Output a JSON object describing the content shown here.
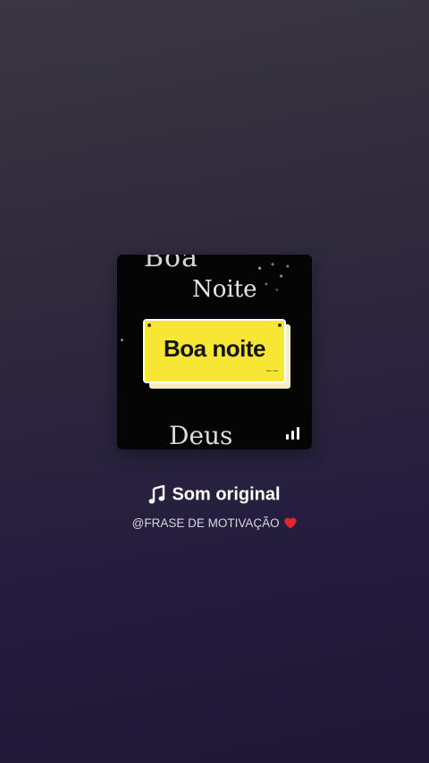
{
  "cover": {
    "text_top": "Boa",
    "text_noite": "Noite",
    "sign_text": "Boa noite",
    "squiggle": "~~",
    "text_bottom": "Deus",
    "playing_icon": "audio-bars-icon"
  },
  "sound": {
    "music_icon": "music-note-icon",
    "title": "Som original",
    "author": "@FRASE DE MOTIVAÇÃO",
    "author_icon": "red-heart-icon"
  },
  "colors": {
    "sign_yellow": "#f7e633",
    "heart_red": "#e0282e",
    "title_white": "#ffffff"
  }
}
